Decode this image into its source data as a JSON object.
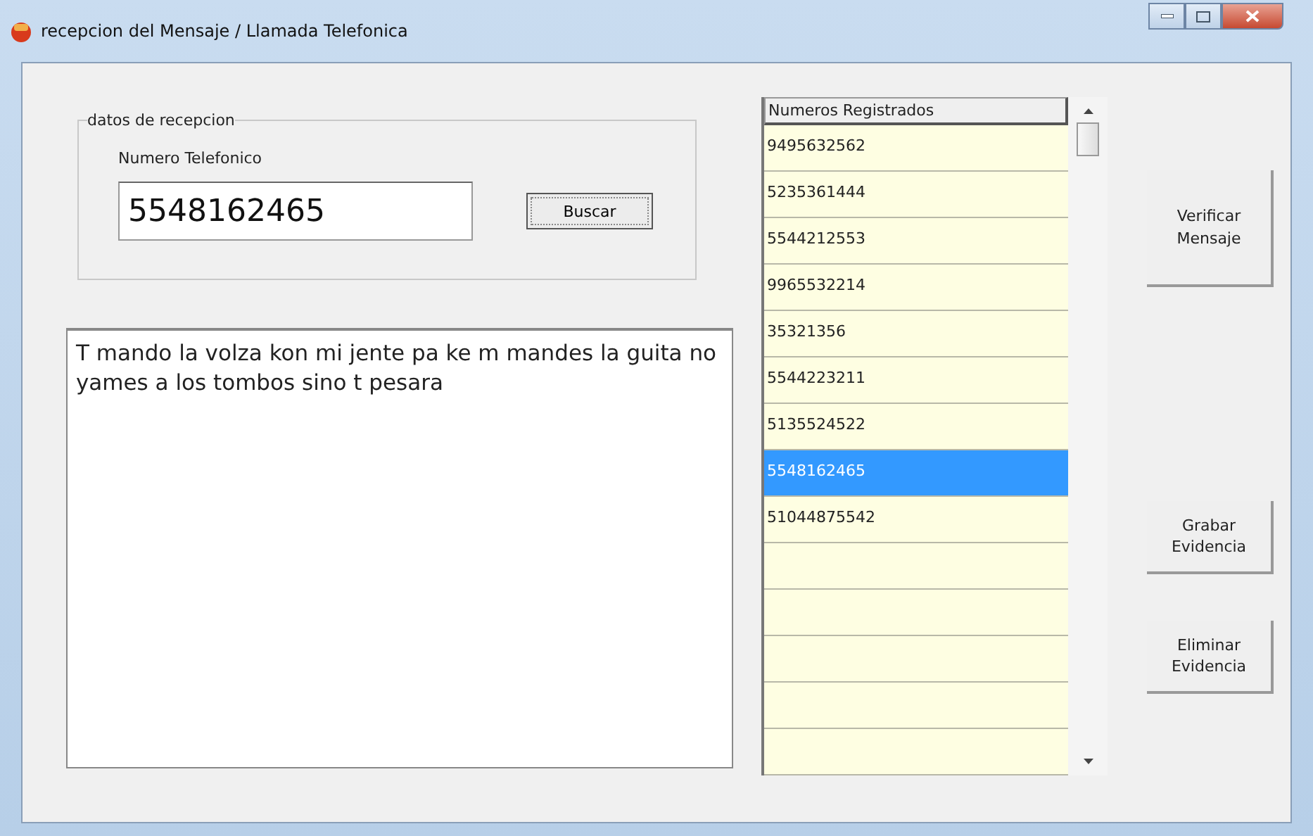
{
  "window": {
    "title": "recepcion del Mensaje / Llamada Telefonica"
  },
  "reception_group": {
    "legend": "datos de recepcion",
    "phone_label": "Numero Telefonico",
    "phone_value": "5548162465",
    "search_button": "Buscar"
  },
  "message": "T mando la volza kon mi jente pa ke m mandes la guita no yames a los tombos sino t pesara",
  "numbers_list": {
    "header": "Numeros Registrados",
    "rows": [
      {
        "number": "9495632562",
        "selected": false
      },
      {
        "number": "5235361444",
        "selected": false
      },
      {
        "number": "5544212553",
        "selected": false
      },
      {
        "number": "9965532214",
        "selected": false
      },
      {
        "number": "35321356",
        "selected": false
      },
      {
        "number": "5544223211",
        "selected": false
      },
      {
        "number": "5135524522",
        "selected": false
      },
      {
        "number": "5548162465",
        "selected": true
      },
      {
        "number": "51044875542",
        "selected": false
      }
    ]
  },
  "buttons": [
    {
      "label": "Verificar Mensaje"
    },
    {
      "label": "Grabar Evidencia"
    },
    {
      "label": "Eliminar Evidencia"
    }
  ]
}
